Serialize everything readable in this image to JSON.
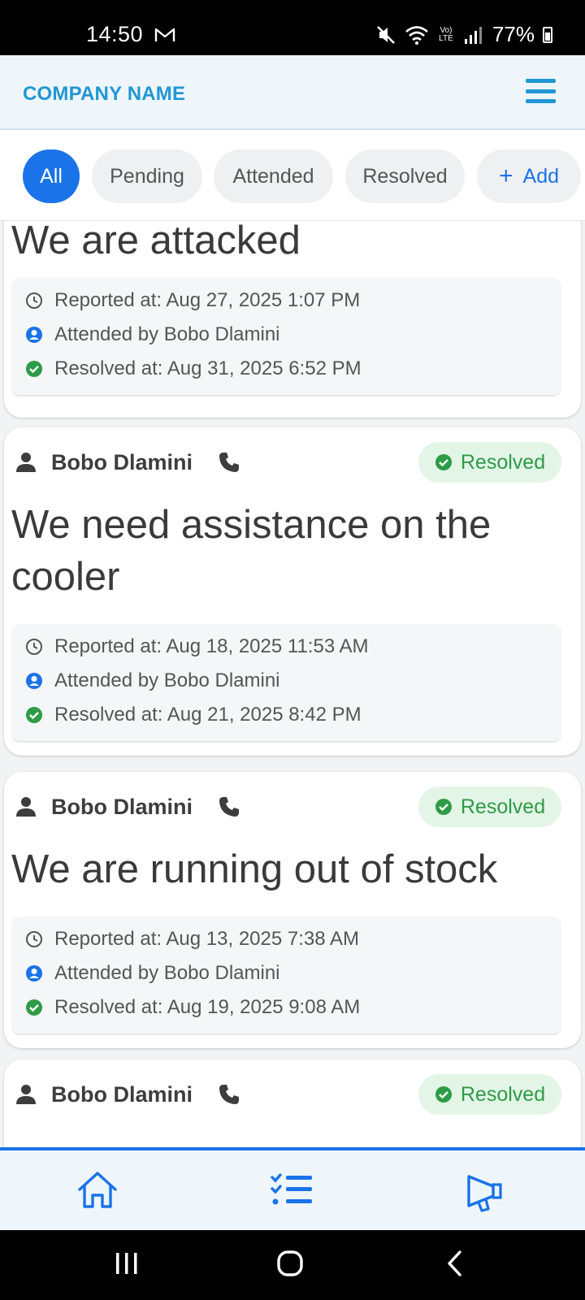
{
  "status_bar": {
    "time": "14:50",
    "mail_glyph": "M",
    "volte": "Vo) LTE",
    "battery": "77%"
  },
  "header": {
    "company_name": "COMPANY NAME"
  },
  "filters": {
    "chips": [
      "All",
      "Pending",
      "Attended",
      "Resolved"
    ],
    "add_label": "Add",
    "active": "All"
  },
  "colors": {
    "brand_blue": "#2196d3",
    "accent_blue": "#1a73e8",
    "resolved_green": "#2e9b46",
    "resolved_bg": "#e3f5e7"
  },
  "tickets": [
    {
      "user": "",
      "title": "We are attacked",
      "status": "",
      "reported": "Reported at: Aug 27, 2025 1:07 PM",
      "attended": "Attended by Bobo Dlamini",
      "resolved": "Resolved at: Aug 31, 2025 6:52 PM"
    },
    {
      "user": "Bobo Dlamini",
      "title": "We need assistance on the cooler",
      "status": "Resolved",
      "reported": "Reported at: Aug 18, 2025 11:53 AM",
      "attended": "Attended by Bobo Dlamini",
      "resolved": "Resolved at: Aug 21, 2025 8:42 PM"
    },
    {
      "user": "Bobo Dlamini",
      "title": "We are running out of stock",
      "status": "Resolved",
      "reported": "Reported at: Aug 13, 2025 7:38 AM",
      "attended": "Attended by Bobo Dlamini",
      "resolved": "Resolved at: Aug 19, 2025 9:08 AM"
    },
    {
      "user": "Bobo Dlamini",
      "title": "",
      "status": "Resolved"
    }
  ],
  "icons": {
    "clock": "clock-icon",
    "attended": "user-circle-icon",
    "resolved": "check-circle-icon",
    "user": "person-icon",
    "phone": "phone-icon",
    "menu": "hamburger-menu-icon",
    "nav_home": "home-icon",
    "nav_tasks": "checklist-icon",
    "nav_announce": "megaphone-icon"
  }
}
